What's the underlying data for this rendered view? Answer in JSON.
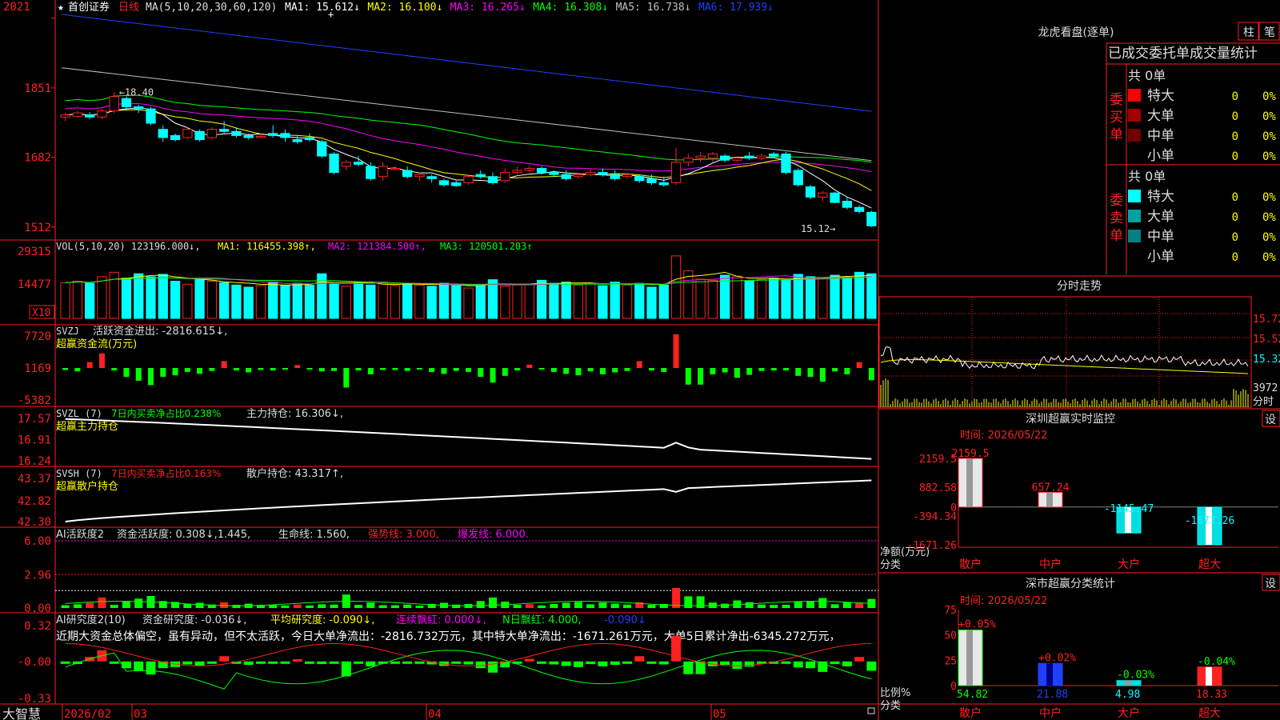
{
  "colors": {
    "up": "#ff2020",
    "down": "#00ffff",
    "bg": "#000000",
    "grid": "#ff2020",
    "ma1": "#ffffff",
    "ma2": "#ffff00",
    "ma3": "#ff00ff",
    "ma4": "#00ff00",
    "ma5": "#c0c0c0",
    "ma6": "#2040ff"
  },
  "header": {
    "star": "★",
    "stock_name": "首创证券",
    "period": "日线",
    "ma_label": "MA(5,10,20,30,60,120)",
    "ma_values": [
      {
        "label": "MA1:",
        "value": "15.612",
        "arrow": "↓",
        "color": "#ffffff"
      },
      {
        "label": "MA2:",
        "value": "16.100",
        "arrow": "↓",
        "color": "#ffff00"
      },
      {
        "label": "MA3:",
        "value": "16.265",
        "arrow": "↓",
        "color": "#ff00ff"
      },
      {
        "label": "MA4:",
        "value": "16.308",
        "arrow": "↓",
        "color": "#00ff00"
      },
      {
        "label": "MA5:",
        "value": "16.738",
        "arrow": "↓",
        "color": "#c0c0c0"
      },
      {
        "label": "MA6:",
        "value": "17.939",
        "arrow": "↓",
        "color": "#2040ff"
      }
    ]
  },
  "kline": {
    "y_ticks": [
      "2021",
      "1851",
      "1682",
      "1512"
    ],
    "high_label": "18.40",
    "low_label": "15.12",
    "y_range": [
      15.0,
      20.3
    ],
    "ohlc": [
      [
        17.8,
        17.9,
        17.7,
        17.85
      ],
      [
        17.82,
        17.95,
        17.78,
        17.9
      ],
      [
        17.85,
        17.92,
        17.75,
        17.8
      ],
      [
        17.8,
        18.0,
        17.75,
        17.95
      ],
      [
        17.95,
        18.4,
        17.9,
        18.3
      ],
      [
        18.25,
        18.3,
        17.95,
        18.05
      ],
      [
        18.05,
        18.1,
        17.9,
        18.0
      ],
      [
        18.0,
        18.05,
        17.6,
        17.65
      ],
      [
        17.5,
        17.6,
        17.2,
        17.3
      ],
      [
        17.35,
        17.4,
        17.2,
        17.25
      ],
      [
        17.3,
        17.55,
        17.25,
        17.5
      ],
      [
        17.45,
        17.5,
        17.2,
        17.25
      ],
      [
        17.3,
        17.55,
        17.25,
        17.5
      ],
      [
        17.5,
        17.7,
        17.4,
        17.45
      ],
      [
        17.45,
        17.55,
        17.3,
        17.35
      ],
      [
        17.35,
        17.4,
        17.25,
        17.3
      ],
      [
        17.3,
        17.4,
        17.28,
        17.33
      ],
      [
        17.4,
        17.6,
        17.3,
        17.35
      ],
      [
        17.4,
        17.5,
        17.2,
        17.3
      ],
      [
        17.25,
        17.35,
        17.15,
        17.2
      ],
      [
        17.3,
        17.4,
        17.2,
        17.25
      ],
      [
        17.2,
        17.25,
        16.8,
        16.85
      ],
      [
        16.9,
        16.95,
        16.4,
        16.45
      ],
      [
        16.6,
        16.75,
        16.5,
        16.7
      ],
      [
        16.7,
        16.85,
        16.6,
        16.65
      ],
      [
        16.6,
        16.7,
        16.25,
        16.3
      ],
      [
        16.35,
        16.7,
        16.25,
        16.6
      ],
      [
        16.55,
        16.6,
        16.5,
        16.55
      ],
      [
        16.5,
        16.6,
        16.3,
        16.35
      ],
      [
        16.35,
        16.45,
        16.25,
        16.4
      ],
      [
        16.35,
        16.4,
        16.2,
        16.3
      ],
      [
        16.25,
        16.3,
        16.1,
        16.15
      ],
      [
        16.2,
        16.25,
        16.1,
        16.13
      ],
      [
        16.2,
        16.4,
        16.15,
        16.35
      ],
      [
        16.4,
        16.5,
        16.3,
        16.35
      ],
      [
        16.35,
        16.45,
        16.15,
        16.2
      ],
      [
        16.25,
        16.55,
        16.2,
        16.45
      ],
      [
        16.45,
        16.6,
        16.4,
        16.5
      ],
      [
        16.5,
        16.6,
        16.45,
        16.55
      ],
      [
        16.55,
        16.6,
        16.4,
        16.45
      ],
      [
        16.45,
        16.5,
        16.35,
        16.4
      ],
      [
        16.4,
        16.5,
        16.25,
        16.3
      ],
      [
        16.35,
        16.45,
        16.3,
        16.4
      ],
      [
        16.4,
        16.55,
        16.35,
        16.45
      ],
      [
        16.45,
        16.55,
        16.35,
        16.4
      ],
      [
        16.4,
        16.5,
        16.25,
        16.3
      ],
      [
        16.35,
        16.45,
        16.3,
        16.4
      ],
      [
        16.35,
        16.4,
        16.2,
        16.25
      ],
      [
        16.3,
        16.4,
        16.15,
        16.2
      ],
      [
        16.2,
        16.35,
        16.1,
        16.15
      ],
      [
        16.2,
        17.05,
        16.15,
        16.7
      ],
      [
        16.7,
        16.9,
        16.6,
        16.8
      ],
      [
        16.8,
        16.95,
        16.7,
        16.85
      ],
      [
        16.8,
        16.95,
        16.7,
        16.9
      ],
      [
        16.85,
        16.9,
        16.7,
        16.75
      ],
      [
        16.75,
        16.85,
        16.7,
        16.8
      ],
      [
        16.85,
        16.95,
        16.75,
        16.8
      ],
      [
        16.8,
        16.9,
        16.75,
        16.85
      ],
      [
        16.9,
        16.95,
        16.8,
        16.85
      ],
      [
        16.9,
        16.95,
        16.4,
        16.45
      ],
      [
        16.5,
        16.55,
        16.1,
        16.15
      ],
      [
        16.1,
        16.15,
        15.8,
        15.85
      ],
      [
        15.85,
        16.0,
        15.75,
        15.95
      ],
      [
        15.95,
        15.98,
        15.7,
        15.72
      ],
      [
        15.75,
        15.85,
        15.55,
        15.6
      ],
      [
        15.6,
        15.65,
        15.45,
        15.5
      ],
      [
        15.48,
        15.52,
        15.12,
        15.15
      ]
    ],
    "ma": {
      "ma6": {
        "start": 20.3,
        "end": 17.94
      },
      "ma5": {
        "start": 19.0,
        "end": 16.74
      }
    }
  },
  "volume": {
    "header": "VOL(5,10,20)",
    "value": "123196.000",
    "ma1": "116455.398",
    "ma2": "121384.500",
    "ma3": "120501.203",
    "y_ticks": [
      "29315",
      "14477"
    ],
    "unit_label": "X10",
    "values": [
      120,
      125,
      118,
      140,
      155,
      135,
      150,
      140,
      148,
      125,
      115,
      130,
      125,
      120,
      112,
      105,
      110,
      122,
      110,
      118,
      112,
      150,
      115,
      108,
      118,
      112,
      122,
      110,
      118,
      112,
      108,
      118,
      110,
      102,
      112,
      130,
      108,
      112,
      115,
      128,
      118,
      122,
      112,
      118,
      110,
      122,
      112,
      118,
      105,
      112,
      210,
      160,
      132,
      128,
      145,
      142,
      125,
      130,
      135,
      128,
      148,
      140,
      135,
      145,
      138,
      155,
      150
    ]
  },
  "svzj": {
    "header": "SVZJ",
    "label": "活跃资金进出:",
    "value": "-2816.615",
    "subtitle": "超赢资金流(万元)",
    "y_ticks": [
      "7720",
      "1169",
      "-5382"
    ],
    "values": [
      -400,
      -700,
      1200,
      3000,
      -500,
      -1800,
      -2600,
      -3500,
      -1800,
      -1500,
      -800,
      -1200,
      -600,
      1400,
      -500,
      -900,
      -400,
      -500,
      -300,
      600,
      -300,
      -700,
      -600,
      -4000,
      -500,
      -1300,
      -400,
      -400,
      -600,
      -200,
      -800,
      -1200,
      -600,
      -800,
      -1800,
      -3000,
      -1600,
      -500,
      700,
      -300,
      -800,
      -1200,
      -1500,
      -700,
      -1300,
      -900,
      -600,
      1400,
      -500,
      -800,
      6900,
      -3400,
      -3400,
      -1300,
      -900,
      -2000,
      -1400,
      -600,
      -500,
      -500,
      -1600,
      -1800,
      -2800,
      -700,
      -1300,
      1200,
      -2500
    ]
  },
  "svzl": {
    "header": "SVZL (7)",
    "label1": "7日内买卖净占比0.238%",
    "label2": "主力持仓:",
    "value": "16.306",
    "subtitle": "超赢主力持仓",
    "y_ticks": [
      "17.57",
      "16.91",
      "16.24"
    ],
    "start": 17.55,
    "end": 16.3
  },
  "svsh": {
    "header": "SVSH (7)",
    "label1": "7日内买卖净占比0.163%",
    "label2": "散户持仓:",
    "value": "43.317",
    "subtitle": "超赢散户持仓",
    "y_ticks": [
      "43.37",
      "42.82",
      "42.30"
    ],
    "start": 42.3,
    "end": 43.32
  },
  "ai_active": {
    "header": "AI活跃度2",
    "label1": "资金活跃度:",
    "value1": "0.308",
    "value2": "1.445",
    "label2": "生命线:",
    "value3": "1.560",
    "label3": "强势线:",
    "value4": "3.000",
    "label4": "爆发线:",
    "value5": "6.000",
    "y_ticks": [
      "6.00",
      "2.96",
      "0.00"
    ]
  },
  "ai_research": {
    "header": "AI研究度2(10)",
    "label1": "资金研究度:",
    "value1": "-0.036",
    "label2": "平均研究度:",
    "value2": "-0.090",
    "label3": "连续飘红:",
    "value3": "0.000",
    "label4": "N日飘红:",
    "value4": "4.000",
    "value5": "-0.090",
    "comment": "近期大资金总体偏空，虽有异动，但不太活跃，今日大单净流出：-2816.732万元，其中特大单净流出：-1671.261万元，大单5日累计净出-6345.272万元，",
    "y_ticks": [
      "0.32",
      "-0.00",
      "-0.33"
    ]
  },
  "footer": {
    "brand": "大智慧",
    "dates": [
      "2026/02",
      "03",
      "04",
      "05"
    ],
    "lock_icon": "lock-icon"
  },
  "right_panel": {
    "longhu_title": "龙虎看盘(逐单)",
    "btn_zhu": "柱",
    "btn_bi": "笔",
    "trade_title": "已成交委托单成交量统计",
    "buy": {
      "side_label": "委买单",
      "total": "共 0单",
      "rows": [
        {
          "label": "特大",
          "color": "#ff0000",
          "value": "0",
          "pct": "0%"
        },
        {
          "label": "大单",
          "color": "#a00000",
          "value": "0",
          "pct": "0%"
        },
        {
          "label": "中单",
          "color": "#700000",
          "value": "0",
          "pct": "0%"
        },
        {
          "label": "小单",
          "color": "",
          "value": "0",
          "pct": "0%"
        }
      ]
    },
    "sell": {
      "side_label": "委卖单",
      "total": "共 0单",
      "rows": [
        {
          "label": "特大",
          "color": "#00ffff",
          "value": "0",
          "pct": "0%"
        },
        {
          "label": "大单",
          "color": "#00a0a0",
          "value": "0",
          "pct": "0%"
        },
        {
          "label": "中单",
          "color": "#008080",
          "value": "0",
          "pct": "0%"
        },
        {
          "label": "小单",
          "color": "",
          "value": "0",
          "pct": "0%"
        }
      ]
    },
    "intraday": {
      "title": "分时走势",
      "y_ticks": [
        "15.72",
        "15.52",
        "15.32"
      ],
      "vol_tick": "3972",
      "vol_label": "分时"
    },
    "monitor": {
      "title": "深圳超赢实时监控",
      "set_btn": "设",
      "time_label": "时间: 2026/05/22",
      "y_ticks": [
        "2159.5",
        "882.58",
        "0",
        "-394.34",
        "-1671.26"
      ],
      "y_label": "净额(万元)",
      "x_label": "分类",
      "categories": [
        "散户",
        "中户",
        "大户",
        "超大"
      ],
      "values": [
        2159.5,
        657.24,
        -1145.47,
        -1671.26
      ],
      "value_labels": [
        "2159.5",
        "657.24",
        "-1145.47",
        "-1671.26"
      ]
    },
    "classify": {
      "title": "深市超赢分类统计",
      "set_btn": "设",
      "time_label": "时间: 2026/05/22",
      "y_ticks": [
        "75",
        "50",
        "25",
        "0"
      ],
      "y_label": "比例%",
      "x_label": "分类",
      "categories": [
        "散户",
        "中户",
        "大户",
        "超大"
      ],
      "values": [
        54.82,
        21.88,
        4.98,
        18.33
      ],
      "changes": [
        "+0.05%",
        "+0.02%",
        "-0.03%",
        "-0.04%"
      ]
    }
  }
}
